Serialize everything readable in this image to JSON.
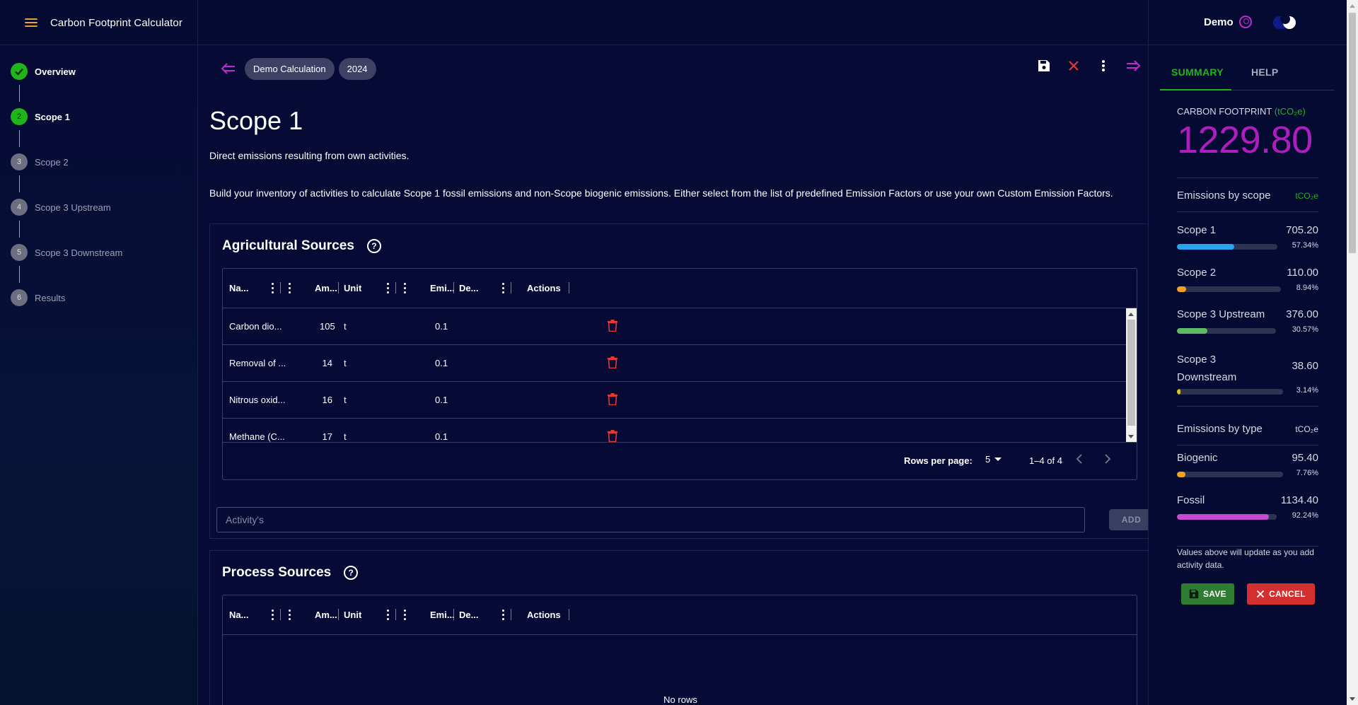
{
  "app": {
    "title": "Carbon Footprint Calculator"
  },
  "user": {
    "name": "Demo"
  },
  "steps": [
    {
      "number": "✓",
      "label": "Overview"
    },
    {
      "number": "2",
      "label": "Scope 1"
    },
    {
      "number": "3",
      "label": "Scope 2"
    },
    {
      "number": "4",
      "label": "Scope 3 Upstream"
    },
    {
      "number": "5",
      "label": "Scope 3 Downstream"
    },
    {
      "number": "6",
      "label": "Results"
    }
  ],
  "breadcrumb": {
    "calculation": "Demo Calculation",
    "year": "2024"
  },
  "page": {
    "title": "Scope 1",
    "description": "Direct emissions resulting from own activities.",
    "instructions": "Build your inventory of activities to calculate Scope 1 fossil emissions and non-Scope biogenic emissions. Either select from the list of predefined Emission Factors or use your own Custom Emission Factors."
  },
  "grid_columns": {
    "name": "Na...",
    "amount": "Am...",
    "unit": "Unit",
    "emission": "Emi...",
    "description": "De...",
    "actions": "Actions"
  },
  "agricultural": {
    "title": "Agricultural Sources",
    "help": "?",
    "rows": [
      {
        "name": "Carbon dio...",
        "amount": "105",
        "unit": "t",
        "emission": "0.1"
      },
      {
        "name": "Removal of ...",
        "amount": "14",
        "unit": "t",
        "emission": "0.1"
      },
      {
        "name": "Nitrous oxid...",
        "amount": "16",
        "unit": "t",
        "emission": "0.1"
      },
      {
        "name": "Methane (C...",
        "amount": "17",
        "unit": "t",
        "emission": "0.1"
      }
    ],
    "footer": {
      "rows_per_page_label": "Rows per page:",
      "rows_per_page": "5",
      "range": "1–4 of 4"
    },
    "activity_placeholder": "Activity's",
    "add_label": "ADD"
  },
  "process": {
    "title": "Process Sources",
    "help": "?",
    "no_rows": "No rows"
  },
  "summary": {
    "tabs": [
      "SUMMARY",
      "HELP"
    ],
    "carbon_footprint_label": "CARBON FOOTPRINT",
    "carbon_footprint_unit": "(tCO₂e)",
    "carbon_footprint_value": "1229.80",
    "by_scope_label": "Emissions by scope",
    "by_scope_unit": "tCO₂e",
    "scopes": [
      {
        "label": "Scope 1",
        "value": "705.20",
        "percent": "57.34%",
        "fraction": 0.5734,
        "color": "#2aa3f0"
      },
      {
        "label": "Scope 2",
        "value": "110.00",
        "percent": "8.94%",
        "fraction": 0.0894,
        "color": "#f2a21c"
      },
      {
        "label": "Scope 3 Upstream",
        "value": "376.00",
        "percent": "30.57%",
        "fraction": 0.3057,
        "color": "#5dbb63"
      },
      {
        "label": "Scope 3 Downstream",
        "value": "38.60",
        "percent": "3.14%",
        "fraction": 0.0314,
        "color": "#d4c51f"
      }
    ],
    "by_type_label": "Emissions by type",
    "by_type_unit": "tCO₂e",
    "types": [
      {
        "label": "Biogenic",
        "value": "95.40",
        "percent": "7.76%",
        "fraction": 0.0776,
        "color": "#f2a21c"
      },
      {
        "label": "Fossil",
        "value": "1134.40",
        "percent": "92.24%",
        "fraction": 0.9224,
        "color": "#c64bd0"
      }
    ],
    "note": "Values above will update as you add activity data.",
    "save_label": "SAVE",
    "cancel_label": "CANCEL"
  },
  "colors": {
    "accent_green": "#1fb51a",
    "accent_magenta": "#b01cbf",
    "danger": "#e53935",
    "background": "#060a34"
  }
}
